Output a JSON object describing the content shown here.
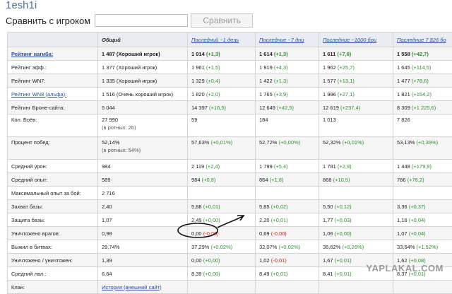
{
  "page": {
    "title": "1esh1i"
  },
  "compare": {
    "label": "Сравнить с игроком",
    "input_value": "",
    "button_label": "Сравнить"
  },
  "table": {
    "headers": [
      "Общий",
      "Последний ~1 день",
      "Последние ~7 дни",
      "Последние ~1000 бои",
      "Последние 7 826 бо"
    ],
    "rows": [
      {
        "label": "Рейтинг нагиба:",
        "c1": "1 487 (Хороший игрок)",
        "c2": "1 914",
        "c2d": "(+1,3)",
        "c3": "1 614",
        "c3d": "(+1,3)",
        "c4": "1 611",
        "c4d": "(+7,6)",
        "c5": "1 558",
        "c5d": "(+42,7)"
      },
      {
        "label": "Рейтинг эфф.:",
        "c1": "1 377 (Хороший игрок)",
        "c2": "1 961",
        "c2d": "(+1,5)",
        "c3": "1 919",
        "c3d": "(+4,3)",
        "c4": "1 962",
        "c4d": "(+25,7)",
        "c5": "1 645",
        "c5d": "(+114,5)"
      },
      {
        "label": "Рейтинг WN7:",
        "c1": "1 335 (Хороший игрок)",
        "c2": "1 329",
        "c2d": "(+0,4)",
        "c3": "1 422",
        "c3d": "(+1,3)",
        "c4": "1 577",
        "c4d": "(+13,1)",
        "c5": "1 477",
        "c5d": "(+78,6)"
      },
      {
        "label": "Рейтинг WN8 (альфа):",
        "c1": "1 516 (Очень хороший игрок)",
        "c2": "1 820",
        "c2d": "(+2,0)",
        "c3": "1 765",
        "c3d": "(+3,9)",
        "c4": "1 996",
        "c4d": "(+27,1)",
        "c5": "1 821",
        "c5d": "(+154,2)"
      },
      {
        "label": "Рейтинг Броне-сайта:",
        "c1": "5 044",
        "c2": "14 397",
        "c2d": "(+16,5)",
        "c3": "12 649",
        "c3d": "(+42,5)",
        "c4": "12 619",
        "c4d": "(+237,4)",
        "c5": "8 309",
        "c5d": "(+1 225,6)"
      },
      {
        "label": "Кол. Боёв:",
        "c1": "27 990",
        "c1sub": "(в ротных: 26)",
        "c2": "59",
        "c3": "184",
        "c4": "1 013",
        "c5": "7 826"
      },
      {
        "label": "Процент побед:",
        "c1": "52,14%",
        "c1sub": "(в ротных: 54%)",
        "c2": "57,63%",
        "c2d": "(+0,01%)",
        "c3": "52,72%",
        "c3d": "(+0,00%)",
        "c4": "52,32%",
        "c4d": "(+0,01%)",
        "c5": "53,13%",
        "c5d": "(+0,38%)"
      },
      {
        "label": "Средний урон:",
        "c1": "984",
        "c2": "2 119",
        "c2d": "(+2,4)",
        "c3": "1 799",
        "c3d": "(+5,4)",
        "c4": "1 781",
        "c4d": "(+2,9)",
        "c5": "1 448",
        "c5d": "(+179,9)"
      },
      {
        "label": "Средний опыт:",
        "c1": "589",
        "c2": "984",
        "c2d": "(+0,8)",
        "c3": "864",
        "c3d": "(+1,8)",
        "c4": "868",
        "c4d": "(+10,5)",
        "c5": "786",
        "c5d": "(+76,2)"
      },
      {
        "label": "Максимальный опыт за бой:",
        "c1": "2 716"
      },
      {
        "label": "Захват базы:",
        "c1": "2,40",
        "c2": "5,88",
        "c2d": "(+0,01)",
        "c3": "5,85",
        "c3d": "(+0,02)",
        "c4": "5,50",
        "c4d": "(+0,12)",
        "c5": "3,36",
        "c5d": "(+0,37)"
      },
      {
        "label": "Защита базы:",
        "c1": "1,07",
        "c2": "2,49",
        "c2d": "(+0,00)",
        "c3": "2,20",
        "c3d": "(+0,01)",
        "c4": "1,77",
        "c4d": "(+0,03)",
        "c5": "1,16",
        "c5d": "(+0,04)"
      },
      {
        "label": "Уничтожено врагов:",
        "c1": "0,98",
        "c2": "0,00",
        "c2d": "(-0,00)",
        "c2neg": true,
        "c3": "0,69",
        "c3d": "(-0,00)",
        "c3neg": true,
        "c4": "1,06",
        "c4d": "(+0,00)",
        "c5": "1,07",
        "c5d": "(+0,04)"
      },
      {
        "label": "Выжил в битвах:",
        "c1": "29,74%",
        "c2": "37,29%",
        "c2d": "(+0,02%)",
        "c3": "32,07%",
        "c3d": "(+0,02%)",
        "c4": "36,62%",
        "c4d": "(+0,26%)",
        "c5": "33,64%",
        "c5d": "(+1,52%)"
      },
      {
        "label": "Уничтожено / уничтожен:",
        "c1": "1,39",
        "c2": "0,00",
        "c2d": "(+0,00)",
        "c3": "1,02",
        "c3d": "(-0,01)",
        "c3neg": true,
        "c4": "1,67",
        "c4d": "(+0,01)",
        "c5": "1,62",
        "c5d": "(+0,08)"
      },
      {
        "label": "Средний лвл.:",
        "c1": "6,64",
        "c2": "8,39",
        "c2d": "(+0,00)",
        "c3": "8,49",
        "c3d": "(+0,01)",
        "c4": "8,41",
        "c4d": "(+0,01)",
        "c5": "8,37",
        "c5d": "(+0,01)"
      },
      {
        "label": "Клан:",
        "c1_link": "История (внешний сайт)"
      }
    ]
  },
  "watermark": "YAPLAKAL.COM",
  "colors": {
    "link": "#2a52a0",
    "positive": "#2f8f2f",
    "negative": "#cc2222",
    "header_bg": "#e9edf2"
  }
}
